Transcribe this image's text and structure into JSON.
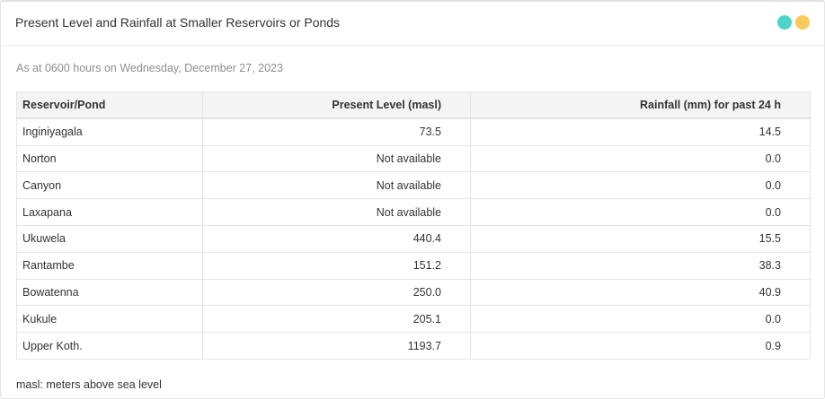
{
  "panel": {
    "title": "Present Level and Rainfall at Smaller Reservoirs or Ponds",
    "colors": {
      "dot_teal": "#4dd4c6",
      "dot_yellow": "#f7cb5b"
    },
    "as_at": "As at 0600 hours on Wednesday, December 27, 2023"
  },
  "table": {
    "headers": [
      "Reservoir/Pond",
      "Present Level (masl)",
      "Rainfall (mm) for past 24 h"
    ],
    "rows": [
      [
        "Inginiyagala",
        "73.5",
        "14.5"
      ],
      [
        "Norton",
        "Not available",
        "0.0"
      ],
      [
        "Canyon",
        "Not available",
        "0.0"
      ],
      [
        "Laxapana",
        "Not available",
        "0.0"
      ],
      [
        "Ukuwela",
        "440.4",
        "15.5"
      ],
      [
        "Rantambe",
        "151.2",
        "38.3"
      ],
      [
        "Bowatenna",
        "250.0",
        "40.9"
      ],
      [
        "Kukule",
        "205.1",
        "0.0"
      ],
      [
        "Upper Koth.",
        "1193.7",
        "0.9"
      ]
    ]
  },
  "footnote": "masl: meters above sea level"
}
